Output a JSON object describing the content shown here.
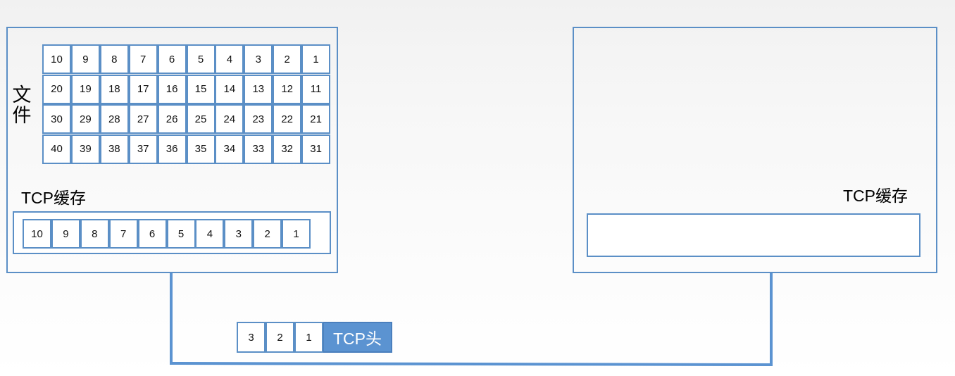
{
  "sender": {
    "file_label": [
      "文",
      "件"
    ],
    "file_rows": [
      [
        "10",
        "9",
        "8",
        "7",
        "6",
        "5",
        "4",
        "3",
        "2",
        "1"
      ],
      [
        "20",
        "19",
        "18",
        "17",
        "16",
        "15",
        "14",
        "13",
        "12",
        "11"
      ],
      [
        "30",
        "29",
        "28",
        "27",
        "26",
        "25",
        "24",
        "23",
        "22",
        "21"
      ],
      [
        "40",
        "39",
        "38",
        "37",
        "36",
        "35",
        "34",
        "33",
        "32",
        "31"
      ]
    ],
    "buffer_label": "TCP缓存",
    "buffer_cells": [
      "10",
      "9",
      "8",
      "7",
      "6",
      "5",
      "4",
      "3",
      "2",
      "1"
    ]
  },
  "receiver": {
    "buffer_label": "TCP缓存",
    "buffer_cells": []
  },
  "segment": {
    "data_cells": [
      "3",
      "2",
      "1"
    ],
    "header_label": "TCP头"
  },
  "colors": {
    "border": "#5b8fc6",
    "header_fill": "#5b93d1",
    "link_line": "#5b93d1"
  }
}
